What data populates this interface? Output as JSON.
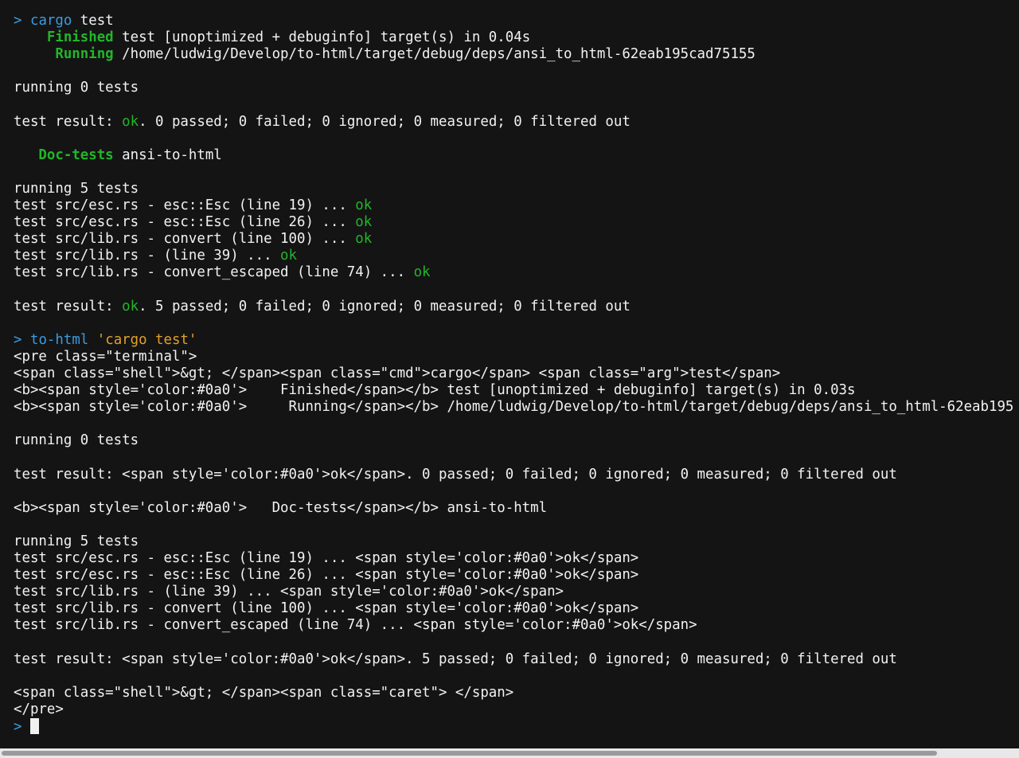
{
  "terminal": {
    "colors": {
      "background": "#141414",
      "text": "#f2f2f2",
      "green": "#22b52a",
      "blue": "#3a9be0",
      "orange": "#e3a02a",
      "cursor": "#f0f0f0",
      "scrollbar_track": "#e8e8e8",
      "scrollbar_thumb": "#9a9a9a"
    },
    "lines": [
      [
        {
          "t": ">",
          "c": "blue"
        },
        {
          "t": " "
        },
        {
          "t": "cargo",
          "c": "blue"
        },
        {
          "t": " test"
        }
      ],
      [
        {
          "t": "    "
        },
        {
          "t": "Finished",
          "c": "green-bold"
        },
        {
          "t": " test [unoptimized + debuginfo] target(s) in 0.04s"
        }
      ],
      [
        {
          "t": "     "
        },
        {
          "t": "Running",
          "c": "green-bold"
        },
        {
          "t": " /home/ludwig/Develop/to-html/target/debug/deps/ansi_to_html-62eab195cad75155"
        }
      ],
      [],
      [
        {
          "t": "running 0 tests"
        }
      ],
      [],
      [
        {
          "t": "test result: "
        },
        {
          "t": "ok",
          "c": "green"
        },
        {
          "t": ". 0 passed; 0 failed; 0 ignored; 0 measured; 0 filtered out"
        }
      ],
      [],
      [
        {
          "t": "   "
        },
        {
          "t": "Doc-tests",
          "c": "green-bold"
        },
        {
          "t": " ansi-to-html"
        }
      ],
      [],
      [
        {
          "t": "running 5 tests"
        }
      ],
      [
        {
          "t": "test src/esc.rs - esc::Esc (line 19) ... "
        },
        {
          "t": "ok",
          "c": "green"
        }
      ],
      [
        {
          "t": "test src/esc.rs - esc::Esc (line 26) ... "
        },
        {
          "t": "ok",
          "c": "green"
        }
      ],
      [
        {
          "t": "test src/lib.rs - convert (line 100) ... "
        },
        {
          "t": "ok",
          "c": "green"
        }
      ],
      [
        {
          "t": "test src/lib.rs - (line 39) ... "
        },
        {
          "t": "ok",
          "c": "green"
        }
      ],
      [
        {
          "t": "test src/lib.rs - convert_escaped (line 74) ... "
        },
        {
          "t": "ok",
          "c": "green"
        }
      ],
      [],
      [
        {
          "t": "test result: "
        },
        {
          "t": "ok",
          "c": "green"
        },
        {
          "t": ". 5 passed; 0 failed; 0 ignored; 0 measured; 0 filtered out"
        }
      ],
      [],
      [
        {
          "t": ">",
          "c": "blue"
        },
        {
          "t": " "
        },
        {
          "t": "to-html",
          "c": "blue"
        },
        {
          "t": " "
        },
        {
          "t": "'cargo test'",
          "c": "orange"
        }
      ],
      [
        {
          "t": "<pre class=\"terminal\">"
        }
      ],
      [
        {
          "t": "<span class=\"shell\">&gt; </span><span class=\"cmd\">cargo</span> <span class=\"arg\">test</span>"
        }
      ],
      [
        {
          "t": "<b><span style='color:#0a0'>    Finished</span></b> test [unoptimized + debuginfo] target(s) in 0.03s"
        }
      ],
      [
        {
          "t": "<b><span style='color:#0a0'>     Running</span></b> /home/ludwig/Develop/to-html/target/debug/deps/ansi_to_html-62eab195"
        }
      ],
      [],
      [
        {
          "t": "running 0 tests"
        }
      ],
      [],
      [
        {
          "t": "test result: <span style='color:#0a0'>ok</span>. 0 passed; 0 failed; 0 ignored; 0 measured; 0 filtered out"
        }
      ],
      [],
      [
        {
          "t": "<b><span style='color:#0a0'>   Doc-tests</span></b> ansi-to-html"
        }
      ],
      [],
      [
        {
          "t": "running 5 tests"
        }
      ],
      [
        {
          "t": "test src/esc.rs - esc::Esc (line 19) ... <span style='color:#0a0'>ok</span>"
        }
      ],
      [
        {
          "t": "test src/esc.rs - esc::Esc (line 26) ... <span style='color:#0a0'>ok</span>"
        }
      ],
      [
        {
          "t": "test src/lib.rs - (line 39) ... <span style='color:#0a0'>ok</span>"
        }
      ],
      [
        {
          "t": "test src/lib.rs - convert (line 100) ... <span style='color:#0a0'>ok</span>"
        }
      ],
      [
        {
          "t": "test src/lib.rs - convert_escaped (line 74) ... <span style='color:#0a0'>ok</span>"
        }
      ],
      [],
      [
        {
          "t": "test result: <span style='color:#0a0'>ok</span>. 5 passed; 0 failed; 0 ignored; 0 measured; 0 filtered out"
        }
      ],
      [],
      [
        {
          "t": "<span class=\"shell\">&gt; </span><span class=\"caret\"> </span>"
        }
      ],
      [
        {
          "t": "</pre>"
        }
      ],
      [
        {
          "t": ">",
          "c": "blue"
        },
        {
          "t": " "
        },
        {
          "cursor": true
        }
      ]
    ]
  }
}
